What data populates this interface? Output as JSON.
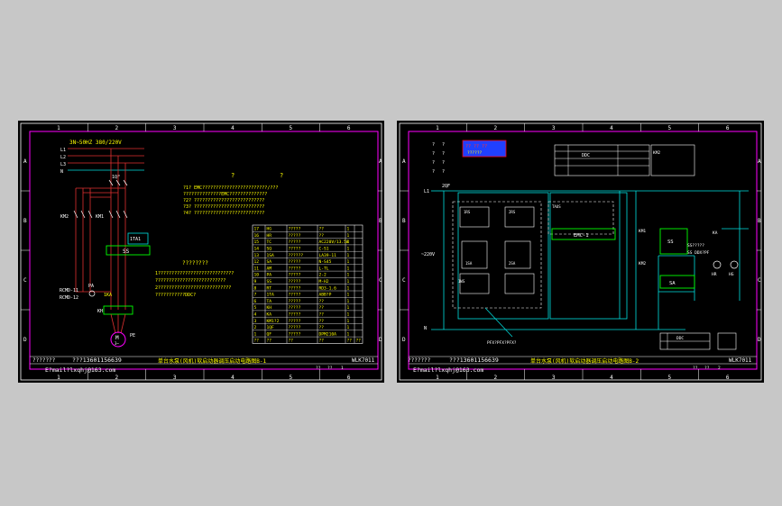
{
  "sheets": [
    {
      "grid_cols": [
        "1",
        "2",
        "3",
        "4",
        "5",
        "6"
      ],
      "grid_rows": [
        "A",
        "B",
        "C",
        "D"
      ],
      "supply_label": "3N~50HZ 380/220V",
      "phase_labels": [
        "L1",
        "L2",
        "L3",
        "N"
      ],
      "qf_label": "1QF",
      "km_labels": [
        "KM2",
        "KM1"
      ],
      "ta_label": "1TA1",
      "ss_label": "SS",
      "rt_labels": [
        "RCMD-11",
        "RCMD-12"
      ],
      "pa_label": "PA",
      "ka_label": "1KA",
      "kh_label": "KH",
      "motor_label": "M",
      "motor_sub": "3~",
      "pe_label": "PE",
      "heading_q": [
        "?",
        "?"
      ],
      "notes1": [
        "?1? EMC????????????????????????/???",
        "    ??????????????EMC??????????????",
        "?2? ??????????????????????????",
        "?3? ??????????????????????????",
        "?4? ??????????????????????????"
      ],
      "heading2": "????????",
      "notes2": [
        "1????????????????????????????",
        "  ??????????????????????????",
        "2???????????????????????????",
        "  ???????????DDC?"
      ],
      "parts_table": [
        [
          "17",
          "HG",
          "?????",
          "??",
          "1",
          ""
        ],
        [
          "16",
          "HR",
          "?????",
          "??",
          "1",
          ""
        ],
        [
          "15",
          "TC",
          "?????",
          "AC220V/13.5W",
          "1",
          ""
        ],
        [
          "14",
          "SQ",
          "?????",
          "C-S1",
          "1",
          ""
        ],
        [
          "13",
          "1SA",
          "??????",
          "LA39-11",
          "1",
          ""
        ],
        [
          "12",
          "SA",
          "?????",
          "N-S45",
          "1",
          ""
        ],
        [
          "11",
          "AM",
          "?????",
          "L-TL",
          "1",
          ""
        ],
        [
          "10",
          "PA",
          "?????",
          "2-2",
          "1",
          ""
        ],
        [
          "9",
          "SS",
          "?????",
          "M-H2",
          "1",
          ""
        ],
        [
          "8",
          "RT",
          "?????",
          "RD3-1.6",
          "1",
          ""
        ],
        [
          "7",
          "1TA",
          "?????",
          "ABB?P",
          "1",
          ""
        ],
        [
          "6",
          "TA",
          "?????",
          "??",
          "1",
          ""
        ],
        [
          "5",
          "KH",
          "?????",
          "??",
          "1",
          ""
        ],
        [
          "4",
          "KA",
          "?????",
          "??",
          "1",
          ""
        ],
        [
          "3",
          "KM1?2",
          "?????",
          "??",
          "1",
          ""
        ],
        [
          "2",
          "1QF",
          "?????",
          "??",
          "1",
          ""
        ],
        [
          "1",
          "QF",
          "?????",
          "DPM210A",
          "1",
          ""
        ],
        [
          "??",
          "??",
          "??",
          "??",
          "??",
          "??"
        ]
      ],
      "footer_phone": "???13601156639",
      "footer_q": "???????",
      "footer_email": "E?mail?lxqhj@163.com",
      "footer_title": "单台水泵(风机)软启动器调压启动电路图B-1",
      "footer_code": "WLK7011",
      "footer_sub": [
        "??",
        "??",
        "1"
      ]
    },
    {
      "grid_cols": [
        "1",
        "2",
        "3",
        "4",
        "5",
        "6"
      ],
      "grid_rows": [
        "A",
        "B",
        "C",
        "D"
      ],
      "logo_text": "?? ?? ??",
      "logo_sub": "??????",
      "supply_label": "~220V",
      "l1_label": "L1",
      "n_label": "N",
      "qf_label": "2QF",
      "ddc_label": "DDC",
      "emc_label": "EMC-1",
      "ss_label": "SS",
      "sa_label": "SA",
      "hr_label": "HR",
      "hg_label": "HG",
      "km_labels": [
        "KM1",
        "KM2",
        "KM1"
      ],
      "ws_label": "1WS",
      "relay_labels": [
        "1RS",
        "2RS",
        "1SA",
        "2SA"
      ],
      "box_labels": [
        "TAUS",
        "?????"
      ],
      "bottom_note": "PFX?PFX?PFX?",
      "ddc_table_label": "DDC",
      "right_labels": [
        "KA",
        "SS?????",
        "SS DDX?PF"
      ],
      "footer_phone": "???13601156639",
      "footer_q": "???????",
      "footer_email": "E?mail?lxqhj@163.com",
      "footer_title": "单台水泵(风机)软启动器调压启动电路图B-2",
      "footer_code": "WLK7011",
      "footer_sub": [
        "??",
        "??",
        "2"
      ]
    }
  ],
  "colors": {
    "background": "#c7c7c7",
    "sheet": "#000000",
    "frame": "#ff00ff",
    "wire_red": "#e03030",
    "wire_cyan": "#00e0e0",
    "text_yellow": "#ffff00",
    "text_white": "#ffffff",
    "accent_green": "#00ff00",
    "logo_blue": "#2040ff"
  }
}
